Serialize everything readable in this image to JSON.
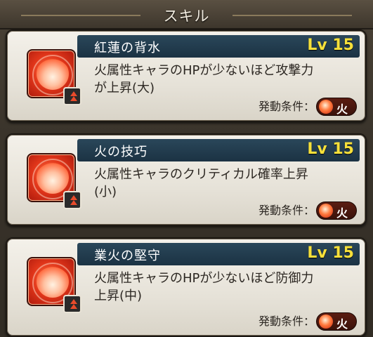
{
  "header": {
    "title": "スキル"
  },
  "colors": {
    "title_bar": "#1b3243",
    "level_text": "#f6e03a",
    "element_fire": "#e2361a"
  },
  "skills": [
    {
      "name": "紅蓮の背水",
      "level": "Lv 15",
      "icon": "fire-flame-icon",
      "badge_icon": "backwater-up-badge-icon",
      "desc_line1": "火属性キャラのHPが少ないほど攻撃力",
      "desc_line2": "が上昇(大)",
      "condition_label": "発動条件：",
      "condition_element": "火"
    },
    {
      "name": "火の技巧",
      "level": "Lv 15",
      "icon": "fire-flame-icon",
      "badge_icon": "critical-up-badge-icon",
      "desc_line1": "火属性キャラのクリティカル確率上昇",
      "desc_line2": "(小)",
      "condition_label": "発動条件：",
      "condition_element": "火"
    },
    {
      "name": "業火の堅守",
      "level": "Lv 15",
      "icon": "fire-flame-icon",
      "badge_icon": "defense-up-badge-icon",
      "desc_line1": "火属性キャラのHPが少ないほど防御力",
      "desc_line2": "上昇(中)",
      "condition_label": "発動条件：",
      "condition_element": "火"
    }
  ]
}
